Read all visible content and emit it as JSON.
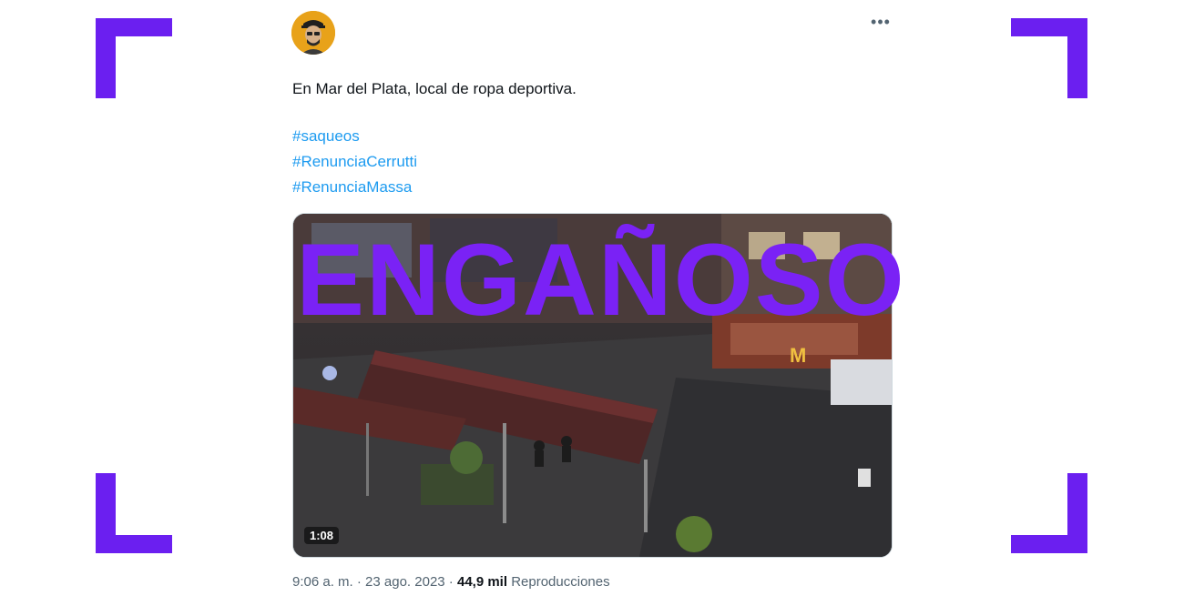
{
  "tweet": {
    "text": "En Mar del Plata, local de ropa deportiva.",
    "hashtags": [
      "#saqueos",
      "#RenunciaCerrutti",
      "#RenunciaMassa"
    ],
    "more_icon": "more-horizontal-icon"
  },
  "media": {
    "duration": "1:08",
    "storefront_sign": "M"
  },
  "verdict": {
    "label": "ENGAÑOSO",
    "color": "#7a22f5"
  },
  "meta": {
    "time": "9:06 a. m.",
    "sep1": " · ",
    "date": "23 ago. 2023",
    "sep2": " · ",
    "views": "44,9 mil",
    "views_label": "Reproducciones"
  },
  "frame": {
    "accent": "#6b1ff0"
  }
}
